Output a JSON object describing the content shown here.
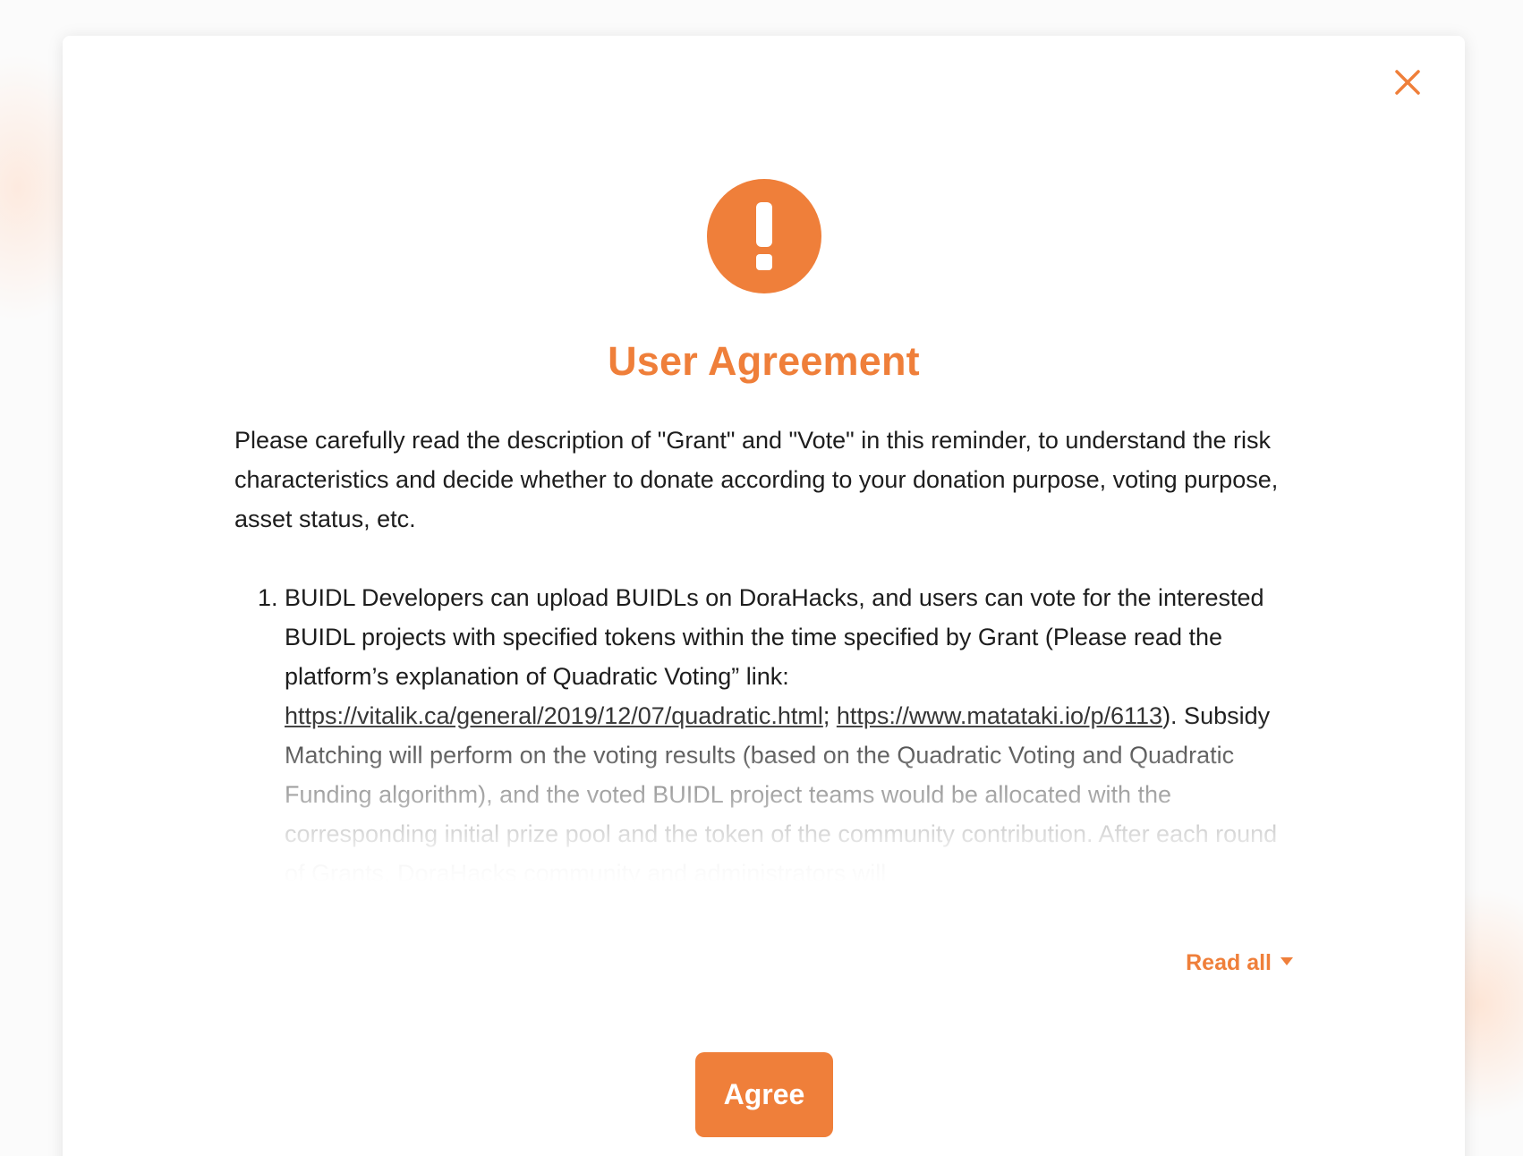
{
  "colors": {
    "accent": "#ef7f3a",
    "text": "#1d1d1d",
    "background": "#ffffff"
  },
  "modal": {
    "close_icon": "close-icon",
    "warning_icon": "exclamation-circle-icon",
    "title": "User Agreement",
    "intro": "Please carefully read the description of \"Grant\" and \"Vote\" in this reminder, to understand the risk characteristics and decide whether to donate according to your donation purpose, voting purpose, asset status, etc.",
    "terms": [
      {
        "number": "1.",
        "text_before_links": "BUIDL Developers can upload BUIDLs on DoraHacks, and users can vote for the interested BUIDL projects with specified tokens within the time specified by Grant (Please read the platform’s explanation of Quadratic Voting” link: ",
        "link1": "https://vitalik.ca/general/2019/12/07/quadratic.html",
        "separator": "; ",
        "link2": "https://www.matataki.io/p/6113",
        "text_after_links": "). Subsidy Matching will perform on the voting results (based on the Quadratic Voting and Quadratic Funding algorithm), and the voted BUIDL project teams would be allocated with the corresponding initial prize pool and the token of the community contribution. After each round of Grants, DoraHacks community and administrators will"
      }
    ],
    "read_all_label": "Read all",
    "agree_label": "Agree"
  }
}
